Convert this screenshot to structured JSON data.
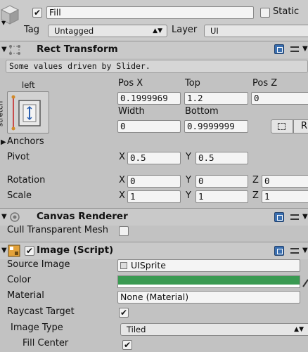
{
  "header": {
    "object_name": "Fill",
    "active_checked": true,
    "static_label": "Static",
    "static_checked": false,
    "tag_label": "Tag",
    "tag_value": "Untagged",
    "layer_label": "Layer",
    "layer_value": "UI"
  },
  "rect_transform": {
    "title": "Rect Transform",
    "driven_note": "Some values driven by Slider.",
    "anchor_top": "left",
    "anchor_side": "stretch",
    "col1_top": "Pos X",
    "col2_top": "Top",
    "col3_top": "Pos Z",
    "pos_x": "0.1999969",
    "top": "1.2",
    "pos_z": "0",
    "col1_bottom": "Width",
    "col2_bottom": "Bottom",
    "width": "0",
    "bottom": "0.9999999",
    "raw_btn": "R",
    "anchors_label": "Anchors",
    "pivot_label": "Pivot",
    "pivot_x": "0.5",
    "pivot_y": "0.5",
    "rotation_label": "Rotation",
    "rot_x": "0",
    "rot_y": "0",
    "rot_z": "0",
    "scale_label": "Scale",
    "scale_x": "1",
    "scale_y": "1",
    "scale_z": "1",
    "axis_x": "X",
    "axis_y": "Y",
    "axis_z": "Z"
  },
  "canvas_renderer": {
    "title": "Canvas Renderer",
    "cull_label": "Cull Transparent Mesh",
    "cull_checked": false
  },
  "image": {
    "title": "Image (Script)",
    "enabled": true,
    "source_label": "Source Image",
    "source_value": "UISprite",
    "color_label": "Color",
    "color_value": "#3a9a52",
    "material_label": "Material",
    "material_value": "None (Material)",
    "raycast_label": "Raycast Target",
    "raycast_checked": true,
    "type_label": "Image Type",
    "type_value": "Tiled",
    "fill_center_label": "Fill Center",
    "fill_center_checked": true
  },
  "icons": [
    "gameobject-cube-icon",
    "rect-transform-icon",
    "canvas-renderer-icon",
    "image-icon",
    "help-icon",
    "preset-icon",
    "overflow-icon"
  ]
}
